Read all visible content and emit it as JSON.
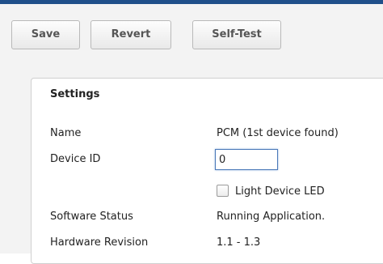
{
  "toolbar": {
    "save_label": "Save",
    "revert_label": "Revert",
    "selftest_label": "Self-Test"
  },
  "settings": {
    "title": "Settings",
    "name_label": "Name",
    "name_value": "PCM (1st device found)",
    "device_id_label": "Device ID",
    "device_id_value": "0",
    "light_led_label": "Light Device LED",
    "light_led_checked": false,
    "software_status_label": "Software Status",
    "software_status_value": "Running Application.",
    "hardware_revision_label": "Hardware Revision",
    "hardware_revision_value": "1.1 - 1.3"
  },
  "colors": {
    "top_bar": "#1f4f8a",
    "toolbar_bg": "#f3f3f3",
    "input_focus_border": "#4a78b8"
  }
}
